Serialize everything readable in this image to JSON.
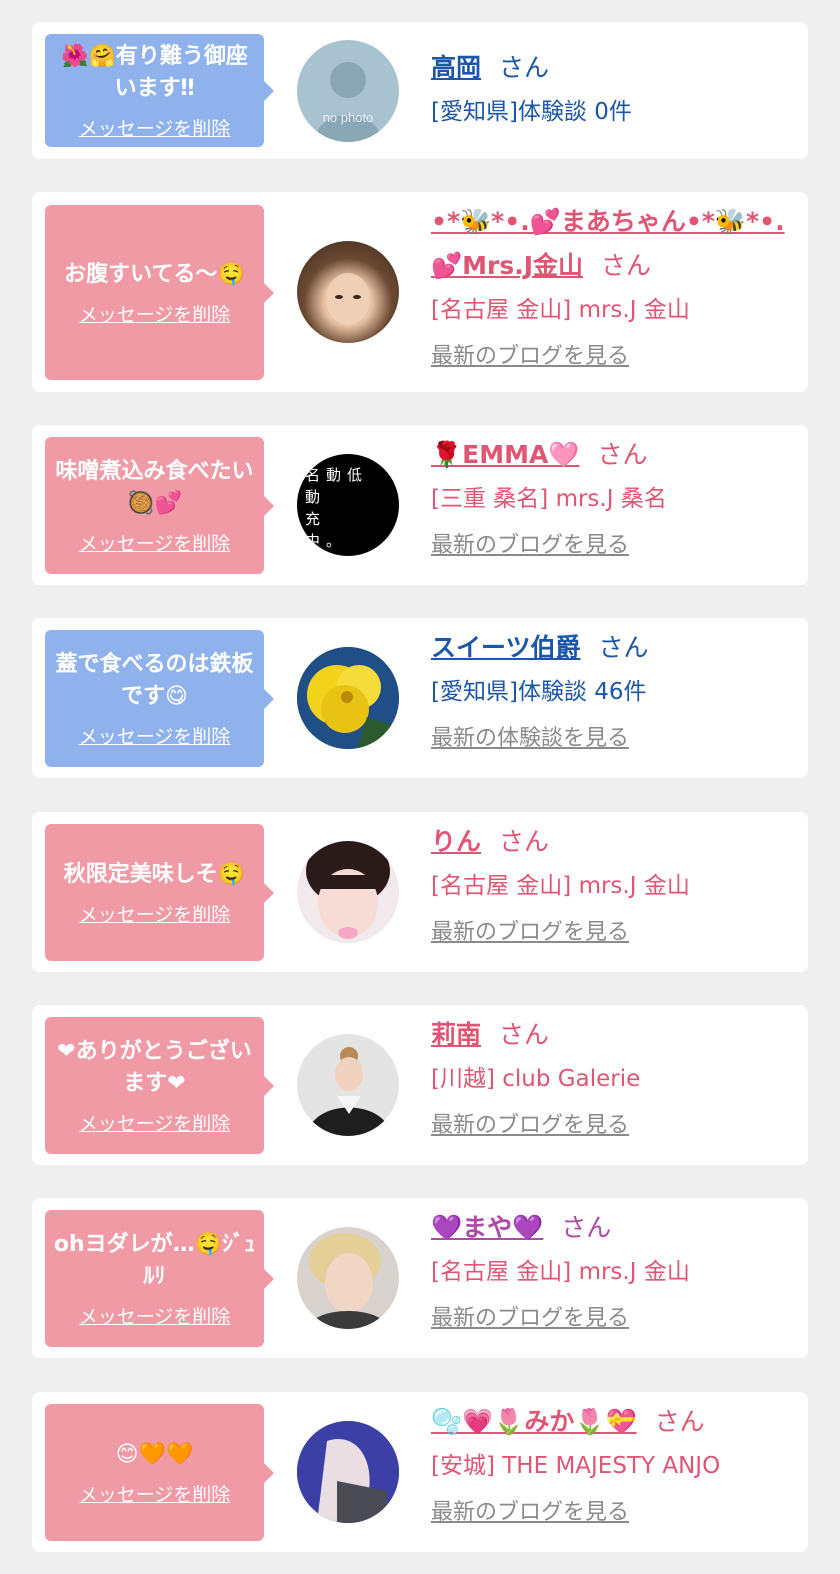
{
  "delete_label": "メッセージを削除",
  "san_label": "さん",
  "colors": {
    "bubble_blue": "#8fb2ed",
    "bubble_pink": "#f09aa6",
    "name_blue": "#1c56a6",
    "name_pink": "#e05574",
    "name_purple": "#b048a8"
  },
  "entries": [
    {
      "message": "🌺🤗有り難う御座います‼",
      "name_line1": "高岡",
      "name_line2": "",
      "detail": "[愛知県]体験談 0件",
      "more": "",
      "avatar": "no photo",
      "avatar_icon": "no-photo-silhouette"
    },
    {
      "message": "お腹すいてる〜🤤",
      "name_line1": "•*🐝*•.💕まあちゃん•*🐝*•.",
      "name_line2": "💕Mrs.J金山",
      "detail": "[名古屋 金山] mrs.J 金山",
      "more": "最新のブログを見る",
      "avatar_icon": "woman-photo"
    },
    {
      "message": "味噌煮込み食べたい🥘💕",
      "name_line1": "🌹EMMA🩷",
      "name_line2": "",
      "detail": "[三重 桑名] mrs.J 桑名",
      "more": "最新のブログを見る",
      "avatar": "名動低\n動\n充\n中。",
      "avatar_icon": "black-text-photo"
    },
    {
      "message": "蓋で食べるのは鉄板です😋",
      "name_line1": "スイーツ伯爵",
      "name_line2": "",
      "detail": "[愛知県]体験談 46件",
      "more": "最新の体験談を見る",
      "avatar_icon": "yellow-flower-photo"
    },
    {
      "message": "秋限定美味しそ🤤",
      "name_line1": "りん",
      "name_line2": "",
      "detail": "[名古屋 金山] mrs.J 金山",
      "more": "最新のブログを見る",
      "avatar_icon": "woman-photo"
    },
    {
      "message": "❤ありがとうございます❤",
      "name_line1": "莉南",
      "name_line2": "",
      "detail": "[川越] club Galerie",
      "more": "最新のブログを見る",
      "avatar_icon": "woman-photo"
    },
    {
      "message": "ohヨダレが…🤤ｼﾞｭﾙﾘ",
      "name_line1": "💜まや💜",
      "name_line2": "",
      "detail": "[名古屋 金山] mrs.J 金山",
      "more": "最新のブログを見る",
      "avatar_icon": "woman-photo"
    },
    {
      "message": "😊🧡🧡",
      "name_line1": "🫧💗🌷みか🌷💝",
      "name_line2": "",
      "detail": "[安城] THE MAJESTY ANJO",
      "more": "最新のブログを見る",
      "avatar_icon": "woman-photo"
    }
  ]
}
